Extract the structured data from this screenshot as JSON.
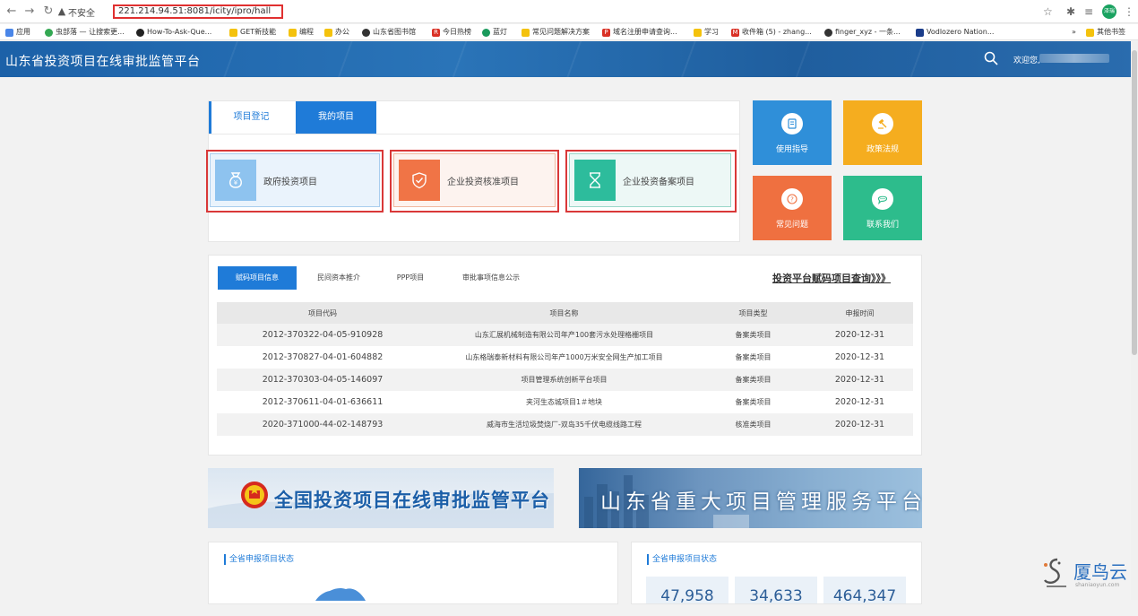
{
  "browser": {
    "security_label": "不安全",
    "url": "221.214.94.51:8081/icity/ipro/hall",
    "profile_initials": "泽瑞",
    "bookmarks": [
      {
        "label": "应用",
        "color": "#4a86e8",
        "glyph": "⋮"
      },
      {
        "label": "虫部落 — 让搜索更...",
        "color": "#34a853",
        "glyph": "●"
      },
      {
        "label": "How-To-Ask-Que...",
        "color": "#222222",
        "glyph": "●"
      },
      {
        "label": "GET新技能",
        "color": "#f4c20d",
        "glyph": ""
      },
      {
        "label": "编程",
        "color": "#f4c20d",
        "glyph": ""
      },
      {
        "label": "办公",
        "color": "#f4c20d",
        "glyph": ""
      },
      {
        "label": "山东省图书馆",
        "color": "#333333",
        "glyph": "●"
      },
      {
        "label": "今日热榜",
        "color": "#d93025",
        "glyph": "R"
      },
      {
        "label": "蓝灯",
        "color": "#1a9a5c",
        "glyph": "●"
      },
      {
        "label": "常见问题解决方案",
        "color": "#f4c20d",
        "glyph": ""
      },
      {
        "label": "域名注册申请查询...",
        "color": "#d93025",
        "glyph": "P"
      },
      {
        "label": "学习",
        "color": "#f4c20d",
        "glyph": ""
      },
      {
        "label": "收件箱 (5) - zhang...",
        "color": "#d93025",
        "glyph": "M"
      },
      {
        "label": "finger_xyz - 一条...",
        "color": "#333333",
        "glyph": "●"
      },
      {
        "label": "Vodlozero Nation...",
        "color": "#1a3c8a",
        "glyph": "✓"
      }
    ],
    "overflow": "»",
    "other_bookmarks": "其他书签"
  },
  "header": {
    "title": "山东省投资项目在线审批监管平台",
    "welcome": "欢迎您,"
  },
  "main_tabs": {
    "register": "项目登记",
    "my_projects": "我的项目"
  },
  "project_types": {
    "government": "政府投资项目",
    "approval": "企业投资核准项目",
    "record": "企业投资备案项目"
  },
  "tiles": {
    "guide": "使用指导",
    "policy": "政策法规",
    "faq": "常见问题",
    "contact": "联系我们"
  },
  "info_tabs": {
    "assigned": "赋码项目信息",
    "private_capital": "民间资本推介",
    "ppp": "PPP项目",
    "approval_info": "审批事项信息公示"
  },
  "query_link": "投资平台赋码项目查询》》》",
  "table": {
    "headers": [
      "项目代码",
      "项目名称",
      "项目类型",
      "申报时间"
    ],
    "rows": [
      [
        "2012-370322-04-05-910928",
        "山东汇展机械制造有限公司年产100套污水处理格栅项目",
        "备案类项目",
        "2020-12-31"
      ],
      [
        "2012-370827-04-01-604882",
        "山东格瑞泰新材料有限公司年产1000万米安全网生产加工项目",
        "备案类项目",
        "2020-12-31"
      ],
      [
        "2012-370303-04-05-146097",
        "项目管理系统创新平台项目",
        "备案类项目",
        "2020-12-31"
      ],
      [
        "2012-370611-04-01-636611",
        "夹河生态城项目1＃地块",
        "备案类项目",
        "2020-12-31"
      ],
      [
        "2020-371000-44-02-148793",
        "威海市生活垃圾焚烧厂-双岛35千伏电缆线路工程",
        "核准类项目",
        "2020-12-31"
      ]
    ]
  },
  "banners": {
    "national": "全国投资项目在线审批监管平台",
    "shandong": "山东省重大项目管理服务平台"
  },
  "bottom": {
    "left_title": "全省申报项目状态",
    "right_title": "全省申报项目状态",
    "stats": [
      "47,958",
      "34,633",
      "464,347"
    ]
  },
  "watermark": {
    "brand": "厦鸟云",
    "domain": "shaniaoyun.com"
  }
}
